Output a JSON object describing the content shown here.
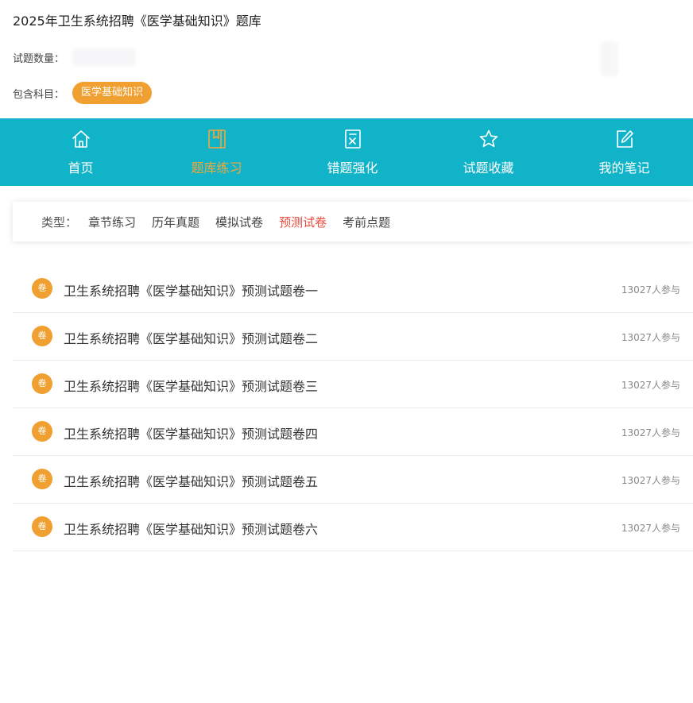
{
  "page": {
    "title": "2025年卫生系统招聘《医学基础知识》题库",
    "count_label": "试题数量：",
    "subject_label": "包含科目：",
    "subject_tag": "医学基础知识"
  },
  "nav": {
    "items": [
      {
        "label": "首页",
        "icon": "home-icon"
      },
      {
        "label": "题库练习",
        "icon": "book-icon",
        "active": true
      },
      {
        "label": "错题强化",
        "icon": "wrong-question-icon"
      },
      {
        "label": "试题收藏",
        "icon": "star-icon"
      },
      {
        "label": "我的笔记",
        "icon": "edit-note-icon"
      }
    ],
    "background": "#11b3c9",
    "active_color": "#f2a83a"
  },
  "type_filter": {
    "label": "类型：",
    "items": [
      "章节练习",
      "历年真题",
      "模拟试卷",
      "预测试卷",
      "考前点题"
    ],
    "active": "预测试卷",
    "active_color": "#e84c3d"
  },
  "papers": {
    "badge": "卷",
    "badge_color": "#f0a030",
    "items": [
      {
        "title": "卫生系统招聘《医学基础知识》预测试题卷一",
        "participants": "13027人参与"
      },
      {
        "title": "卫生系统招聘《医学基础知识》预测试题卷二",
        "participants": "13027人参与"
      },
      {
        "title": "卫生系统招聘《医学基础知识》预测试题卷三",
        "participants": "13027人参与"
      },
      {
        "title": "卫生系统招聘《医学基础知识》预测试题卷四",
        "participants": "13027人参与"
      },
      {
        "title": "卫生系统招聘《医学基础知识》预测试题卷五",
        "participants": "13027人参与"
      },
      {
        "title": "卫生系统招聘《医学基础知识》预测试题卷六",
        "participants": "13027人参与"
      }
    ]
  }
}
